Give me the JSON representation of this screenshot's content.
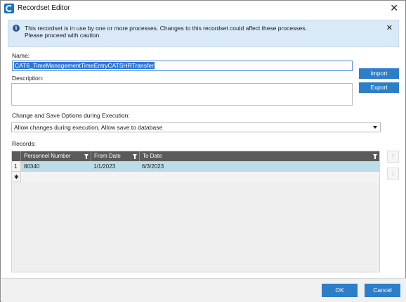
{
  "window": {
    "title": "Recordset Editor",
    "close_glyph": "✕"
  },
  "banner": {
    "line1": "This recordset is in use by one or more processes. Changes to this recordset could affect these processes.",
    "line2": "Please proceed with caution.",
    "icon": "info-icon",
    "close_glyph": "✕"
  },
  "form": {
    "name_label": "Name:",
    "name_value": "CAT6_TimeManagementTimeEntryCATSHRTransfer",
    "description_label": "Description:",
    "description_value": "",
    "options_label": "Change and Save Options during Execution:",
    "options_value": "Allow changes during execution, Allow save to database",
    "records_label": "Records:"
  },
  "side_buttons": {
    "import": "Import",
    "export": "Export"
  },
  "grid": {
    "columns": [
      "Personnel Number",
      "From Date",
      "To Date"
    ],
    "rows": [
      {
        "index": "1",
        "cells": [
          "80340",
          "1/1/2023",
          "6/3/2023"
        ]
      }
    ],
    "new_row_marker": "✱"
  },
  "move_buttons": {
    "up": "↑",
    "down": "↓"
  },
  "footer": {
    "ok": "OK",
    "cancel": "Cancel"
  },
  "colors": {
    "accent": "#2d7ec9",
    "banner_bg": "#d9e9f7",
    "grid_header": "#5a5a5a",
    "selected_row": "#bcdde8"
  }
}
